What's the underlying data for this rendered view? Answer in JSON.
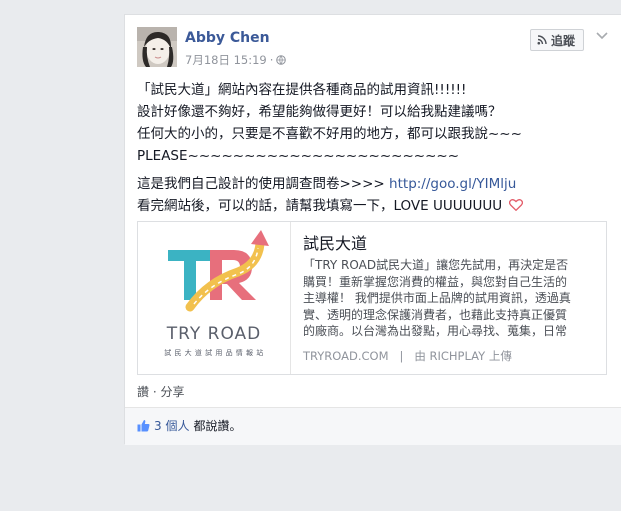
{
  "post": {
    "author": "Abby Chen",
    "timestamp": "7月18日 15:19",
    "separator": "·",
    "follow_label": "追蹤",
    "lines": [
      "「試民大道」網站內容在提供各種商品的試用資訊!!!!!!",
      "設計好像還不夠好，希望能夠做得更好！可以給我點建議嗎？",
      "任何大的小的，只要是不喜歡不好用的地方，都可以跟我說~~~",
      "PLEASE~~~~~~~~~~~~~~~~~~~~~~~~"
    ],
    "survey_prefix": "這是我們自己設計的使用調查問卷>>>> ",
    "survey_link": "http://goo.gl/YIMlju",
    "closing": "看完網站後，可以的話，請幫我填寫一下，LOVE UUUUUUU"
  },
  "attachment": {
    "logo_title": "TRY ROAD",
    "logo_subtitle": "試 民 大 道   試 用 品 情 報 站",
    "title": "試民大道",
    "description_lines": [
      "「TRY ROAD試民大道」讓您先試用，再決定是否",
      "購買！重新掌握您消費的權益，與您對自己生活的",
      "主導權！ 我們提供市面上品牌的試用資訊，透過真",
      "實、透明的理念保護消費者，也藉此支持真正優質",
      "的廠商。以台灣為出發點，用心尋找、蒐集，日常"
    ],
    "source": "TRYROAD.COM",
    "source_sep": "|",
    "uploader": "由 RICHPLAY 上傳"
  },
  "actions": {
    "like": "讚",
    "dot": "·",
    "share": "分享"
  },
  "likes": {
    "count": "3 個人",
    "suffix": "都說讚。"
  },
  "colors": {
    "link": "#365899",
    "logo_teal": "#3bb3c3",
    "logo_pink": "#e76f7c",
    "logo_yellow": "#f2c14e",
    "heart": "#e35d6a"
  },
  "icons": {
    "globe": "globe-icon",
    "rss": "rss-icon",
    "chevron": "chevron-down-icon",
    "heart": "heart-icon",
    "thumb": "thumbs-up-icon"
  }
}
